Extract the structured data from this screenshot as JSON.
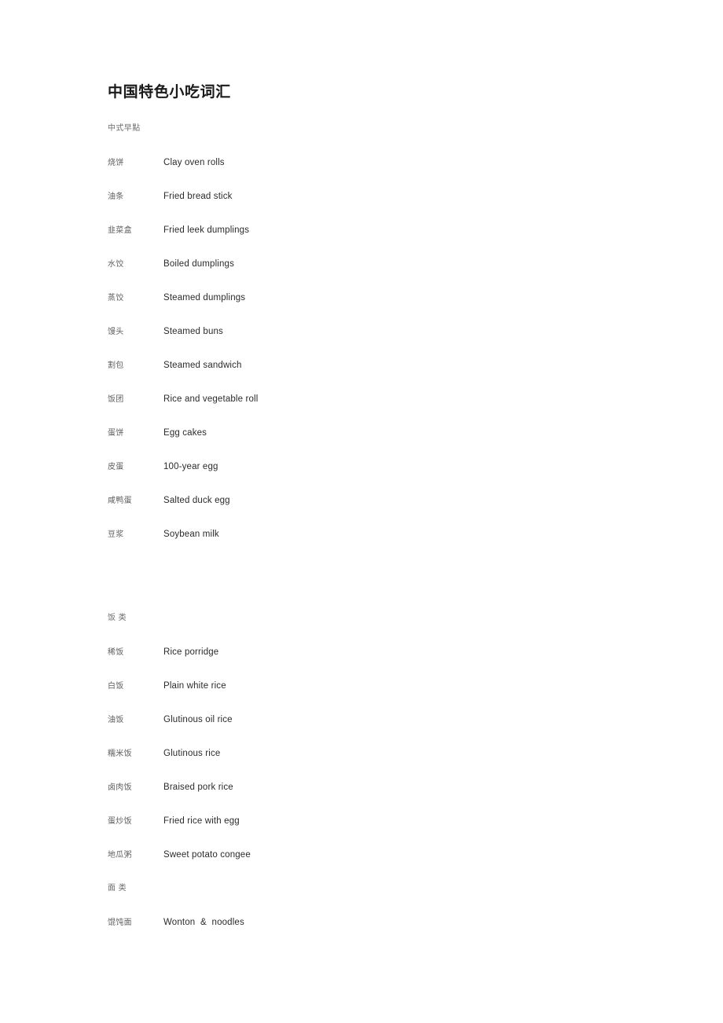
{
  "document": {
    "title": "中国特色小吃词汇",
    "subtitle": "中式早點"
  },
  "sections": [
    {
      "id": "breakfast",
      "heading": "中式早點",
      "entries": [
        {
          "cn": "烧饼",
          "en": "Clay oven rolls"
        },
        {
          "cn": "油条",
          "en": "Fried bread stick"
        },
        {
          "cn": "韭菜盒",
          "en": "Fried leek dumplings"
        },
        {
          "cn": "水饺",
          "en": "Boiled dumplings"
        },
        {
          "cn": "蒸饺",
          "en": "Steamed dumplings"
        },
        {
          "cn": "馒头",
          "en": "Steamed buns"
        },
        {
          "cn": "割包",
          "en": "Steamed sandwich"
        },
        {
          "cn": "饭团",
          "en": "Rice and vegetable roll"
        },
        {
          "cn": "蛋饼",
          "en": "Egg cakes"
        },
        {
          "cn": "皮蛋",
          "en": "100-year egg"
        },
        {
          "cn": "咸鸭蛋",
          "en": "Salted duck egg"
        },
        {
          "cn": "豆浆",
          "en": "Soybean milk"
        }
      ]
    },
    {
      "id": "rice",
      "heading": "饭 类",
      "entries": [
        {
          "cn": "稀饭",
          "en": "Rice porridge"
        },
        {
          "cn": "白饭",
          "en": "Plain white rice"
        },
        {
          "cn": "油饭",
          "en": "Glutinous oil rice"
        },
        {
          "cn": "糯米饭",
          "en": "Glutinous rice"
        },
        {
          "cn": "卤肉饭",
          "en": "Braised pork rice"
        },
        {
          "cn": "蛋炒饭",
          "en": "Fried rice with egg"
        },
        {
          "cn": "地瓜粥",
          "en": "Sweet potato congee"
        }
      ]
    },
    {
      "id": "noodles",
      "heading": "面 类",
      "entries": [
        {
          "cn": "馄饨面",
          "en": "Wonton  &  noodles"
        }
      ]
    }
  ]
}
